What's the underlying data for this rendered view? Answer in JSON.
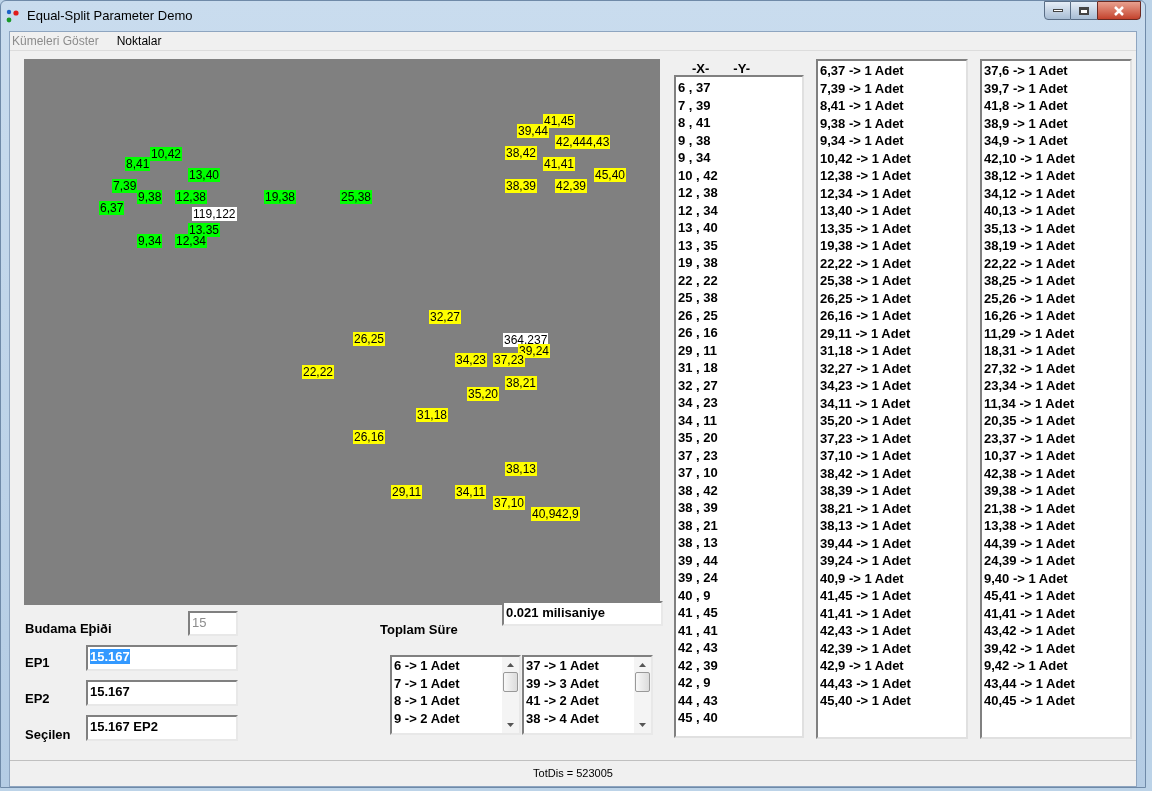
{
  "window": {
    "title": "Equal-Split Parameter Demo"
  },
  "menu": [
    {
      "label": "Kümeleri Göster",
      "disabled": true
    },
    {
      "label": "Noktalar",
      "disabled": false
    }
  ],
  "canvas": {
    "points": [
      {
        "label": "10,42",
        "color": "#00ff00"
      },
      {
        "label": "8,41",
        "color": "#00ff00"
      },
      {
        "label": "13,40",
        "color": "#00ff00"
      },
      {
        "label": "7,39",
        "color": "#00ff00"
      },
      {
        "label": "9,38",
        "color": "#00ff00"
      },
      {
        "label": "12,38",
        "color": "#00ff00"
      },
      {
        "label": "19,38",
        "color": "#00ff00"
      },
      {
        "label": "25,38",
        "color": "#00ff00"
      },
      {
        "label": "6,37",
        "color": "#00ff00"
      },
      {
        "label": "119,122",
        "color": "#ffffff"
      },
      {
        "label": "13,35",
        "color": "#00ff00"
      },
      {
        "label": "9,34",
        "color": "#00ff00"
      },
      {
        "label": "12,34",
        "color": "#00ff00"
      },
      {
        "label": "41,45",
        "color": "#ffff00"
      },
      {
        "label": "39,44",
        "color": "#ffff00"
      },
      {
        "label": "42,444,43",
        "color": "#ffff00"
      },
      {
        "label": "38,42",
        "color": "#ffff00"
      },
      {
        "label": "41,41",
        "color": "#ffff00"
      },
      {
        "label": "45,40",
        "color": "#ffff00"
      },
      {
        "label": "38,39",
        "color": "#ffff00"
      },
      {
        "label": "42,39",
        "color": "#ffff00"
      },
      {
        "label": "32,27",
        "color": "#ffff00"
      },
      {
        "label": "26,25",
        "color": "#ffff00"
      },
      {
        "label": "364,237",
        "color": "#ffffff"
      },
      {
        "label": "39,24",
        "color": "#ffff00"
      },
      {
        "label": "34,23",
        "color": "#ffff00"
      },
      {
        "label": "37,23",
        "color": "#ffff00"
      },
      {
        "label": "22,22",
        "color": "#ffff00"
      },
      {
        "label": "38,21",
        "color": "#ffff00"
      },
      {
        "label": "35,20",
        "color": "#ffff00"
      },
      {
        "label": "31,18",
        "color": "#ffff00"
      },
      {
        "label": "26,16",
        "color": "#ffff00"
      },
      {
        "label": "38,13",
        "color": "#ffff00"
      },
      {
        "label": "29,11",
        "color": "#ffff00"
      },
      {
        "label": "34,11",
        "color": "#ffff00"
      },
      {
        "label": "37,10",
        "color": "#ffff00"
      },
      {
        "label": "40,942,9",
        "color": "#ffff00"
      }
    ]
  },
  "form": {
    "pruning": {
      "label": "Budama Eþiði",
      "value": "15",
      "disabled": true
    },
    "ep1": {
      "label": "EP1",
      "value": "15.167",
      "selected": true
    },
    "ep2": {
      "label": "EP2",
      "value": "15.167",
      "selected": false
    },
    "chosen": {
      "label": "Seçilen",
      "value": "15.167 EP2",
      "selected": false
    },
    "total_time": {
      "label": "Toplam Süre",
      "value": "0.021 milisaniye"
    }
  },
  "small_lists": [
    {
      "items": [
        "6 -> 1 Adet",
        "7 -> 1 Adet",
        "8 -> 1 Adet",
        "9 -> 2 Adet"
      ]
    },
    {
      "items": [
        "37 -> 1 Adet",
        "39 -> 3 Adet",
        "41 -> 2 Adet",
        "38 -> 4 Adet"
      ]
    }
  ],
  "coordinate_list": {
    "header_x": "-X-",
    "header_y": "-Y-",
    "items": [
      "6 , 37",
      "7 , 39",
      "8 , 41",
      "9 , 38",
      "9 , 34",
      "10 , 42",
      "12 , 38",
      "12 , 34",
      "13 , 40",
      "13 , 35",
      "19 , 38",
      "22 , 22",
      "25 , 38",
      "26 , 25",
      "26 , 16",
      "29 , 11",
      "31 , 18",
      "32 , 27",
      "34 , 23",
      "34 , 11",
      "35 , 20",
      "37 , 23",
      "37 , 10",
      "38 , 42",
      "38 , 39",
      "38 , 21",
      "38 , 13",
      "39 , 44",
      "39 , 24",
      "40 , 9",
      "41 , 45",
      "41 , 41",
      "42 , 43",
      "42 , 39",
      "42 , 9",
      "44 , 43",
      "45 , 40"
    ]
  },
  "count_lists": [
    {
      "items": [
        "6,37 -> 1 Adet",
        "7,39 -> 1 Adet",
        "8,41 -> 1 Adet",
        "9,38 -> 1 Adet",
        "9,34 -> 1 Adet",
        "10,42 -> 1 Adet",
        "12,38 -> 1 Adet",
        "12,34 -> 1 Adet",
        "13,40 -> 1 Adet",
        "13,35 -> 1 Adet",
        "19,38 -> 1 Adet",
        "22,22 -> 1 Adet",
        "25,38 -> 1 Adet",
        "26,25 -> 1 Adet",
        "26,16 -> 1 Adet",
        "29,11 -> 1 Adet",
        "31,18 -> 1 Adet",
        "32,27 -> 1 Adet",
        "34,23 -> 1 Adet",
        "34,11 -> 1 Adet",
        "35,20 -> 1 Adet",
        "37,23 -> 1 Adet",
        "37,10 -> 1 Adet",
        "38,42 -> 1 Adet",
        "38,39 -> 1 Adet",
        "38,21 -> 1 Adet",
        "38,13 -> 1 Adet",
        "39,44 -> 1 Adet",
        "39,24 -> 1 Adet",
        "40,9 -> 1 Adet",
        "41,45 -> 1 Adet",
        "41,41 -> 1 Adet",
        "42,43 -> 1 Adet",
        "42,39 -> 1 Adet",
        "42,9 -> 1 Adet",
        "44,43 -> 1 Adet",
        "45,40 -> 1 Adet"
      ]
    },
    {
      "items": [
        "37,6 -> 1 Adet",
        "39,7 -> 1 Adet",
        "41,8 -> 1 Adet",
        "38,9 -> 1 Adet",
        "34,9 -> 1 Adet",
        "42,10 -> 1 Adet",
        "38,12 -> 1 Adet",
        "34,12 -> 1 Adet",
        "40,13 -> 1 Adet",
        "35,13 -> 1 Adet",
        "38,19 -> 1 Adet",
        "22,22 -> 1 Adet",
        "38,25 -> 1 Adet",
        "25,26 -> 1 Adet",
        "16,26 -> 1 Adet",
        "11,29 -> 1 Adet",
        "18,31 -> 1 Adet",
        "27,32 -> 1 Adet",
        "23,34 -> 1 Adet",
        "11,34 -> 1 Adet",
        "20,35 -> 1 Adet",
        "23,37 -> 1 Adet",
        "10,37 -> 1 Adet",
        "42,38 -> 1 Adet",
        "39,38 -> 1 Adet",
        "21,38 -> 1 Adet",
        "13,38 -> 1 Adet",
        "44,39 -> 1 Adet",
        "24,39 -> 1 Adet",
        "9,40 -> 1 Adet",
        "45,41 -> 1 Adet",
        "41,41 -> 1 Adet",
        "43,42 -> 1 Adet",
        "39,42 -> 1 Adet",
        "9,42 -> 1 Adet",
        "43,44 -> 1 Adet",
        "40,45 -> 1 Adet"
      ]
    }
  ],
  "status_bar": "TotDis = 523005"
}
